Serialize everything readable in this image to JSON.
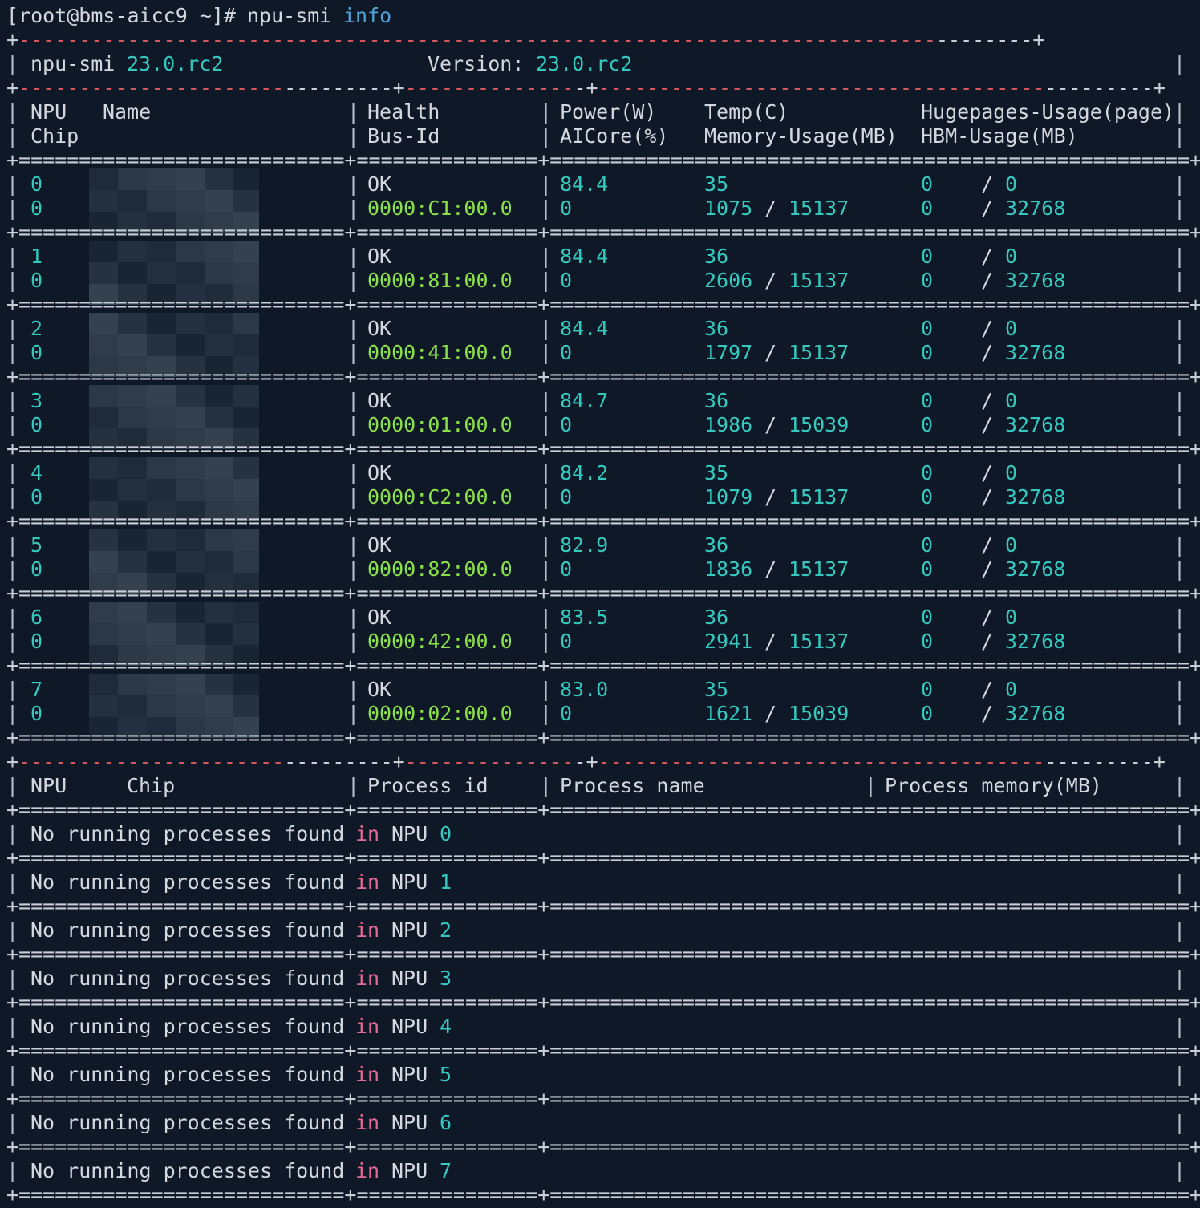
{
  "prompt": {
    "user_host": "[root@bms-aicc9 ~]#",
    "command": "npu-smi",
    "argument": "info"
  },
  "header": {
    "tool": "npu-smi",
    "tool_version": "23.0.rc2",
    "version_label": "Version:",
    "version_value": "23.0.rc2"
  },
  "npu_table": {
    "headers_row1": [
      "NPU",
      "Name",
      "Health",
      "Power(W)",
      "Temp(C)",
      "Hugepages-Usage(page)"
    ],
    "headers_row2": [
      "Chip",
      "Bus-Id",
      "AICore(%)",
      "Memory-Usage(MB)",
      "HBM-Usage(MB)"
    ],
    "rows": [
      {
        "npu": "0",
        "chip": "0",
        "health": "OK",
        "bus_id": "0000:C1:00.0",
        "power": "84.4",
        "aicore": "0",
        "temp": "35",
        "mem_used": "1075",
        "mem_total": "15137",
        "huge_used": "0",
        "huge_total": "0",
        "hbm_used": "0",
        "hbm_total": "32768"
      },
      {
        "npu": "1",
        "chip": "0",
        "health": "OK",
        "bus_id": "0000:81:00.0",
        "power": "84.4",
        "aicore": "0",
        "temp": "36",
        "mem_used": "2606",
        "mem_total": "15137",
        "huge_used": "0",
        "huge_total": "0",
        "hbm_used": "0",
        "hbm_total": "32768"
      },
      {
        "npu": "2",
        "chip": "0",
        "health": "OK",
        "bus_id": "0000:41:00.0",
        "power": "84.4",
        "aicore": "0",
        "temp": "36",
        "mem_used": "1797",
        "mem_total": "15137",
        "huge_used": "0",
        "huge_total": "0",
        "hbm_used": "0",
        "hbm_total": "32768"
      },
      {
        "npu": "3",
        "chip": "0",
        "health": "OK",
        "bus_id": "0000:01:00.0",
        "power": "84.7",
        "aicore": "0",
        "temp": "36",
        "mem_used": "1986",
        "mem_total": "15039",
        "huge_used": "0",
        "huge_total": "0",
        "hbm_used": "0",
        "hbm_total": "32768"
      },
      {
        "npu": "4",
        "chip": "0",
        "health": "OK",
        "bus_id": "0000:C2:00.0",
        "power": "84.2",
        "aicore": "0",
        "temp": "35",
        "mem_used": "1079",
        "mem_total": "15137",
        "huge_used": "0",
        "huge_total": "0",
        "hbm_used": "0",
        "hbm_total": "32768"
      },
      {
        "npu": "5",
        "chip": "0",
        "health": "OK",
        "bus_id": "0000:82:00.0",
        "power": "82.9",
        "aicore": "0",
        "temp": "36",
        "mem_used": "1836",
        "mem_total": "15137",
        "huge_used": "0",
        "huge_total": "0",
        "hbm_used": "0",
        "hbm_total": "32768"
      },
      {
        "npu": "6",
        "chip": "0",
        "health": "OK",
        "bus_id": "0000:42:00.0",
        "power": "83.5",
        "aicore": "0",
        "temp": "36",
        "mem_used": "2941",
        "mem_total": "15137",
        "huge_used": "0",
        "huge_total": "0",
        "hbm_used": "0",
        "hbm_total": "32768"
      },
      {
        "npu": "7",
        "chip": "0",
        "health": "OK",
        "bus_id": "0000:02:00.0",
        "power": "83.0",
        "aicore": "0",
        "temp": "35",
        "mem_used": "1621",
        "mem_total": "15039",
        "huge_used": "0",
        "huge_total": "0",
        "hbm_used": "0",
        "hbm_total": "32768"
      }
    ]
  },
  "process_table": {
    "headers": [
      "NPU",
      "Chip",
      "Process id",
      "Process name",
      "Process memory(MB)"
    ],
    "rows": [
      {
        "text": "No running processes found",
        "kw": "in",
        "label": "NPU",
        "npu": "0"
      },
      {
        "text": "No running processes found",
        "kw": "in",
        "label": "NPU",
        "npu": "1"
      },
      {
        "text": "No running processes found",
        "kw": "in",
        "label": "NPU",
        "npu": "2"
      },
      {
        "text": "No running processes found",
        "kw": "in",
        "label": "NPU",
        "npu": "3"
      },
      {
        "text": "No running processes found",
        "kw": "in",
        "label": "NPU",
        "npu": "4"
      },
      {
        "text": "No running processes found",
        "kw": "in",
        "label": "NPU",
        "npu": "5"
      },
      {
        "text": "No running processes found",
        "kw": "in",
        "label": "NPU",
        "npu": "6"
      },
      {
        "text": "No running processes found",
        "kw": "in",
        "label": "NPU",
        "npu": "7"
      }
    ]
  },
  "colors": {
    "background": "#0e1827",
    "text": "#d4d8de",
    "number": "#35c8be",
    "bus_id": "#8be04a",
    "keyword_in": "#e26a94",
    "argument": "#4fa3d8",
    "dash": "#d4565e"
  }
}
